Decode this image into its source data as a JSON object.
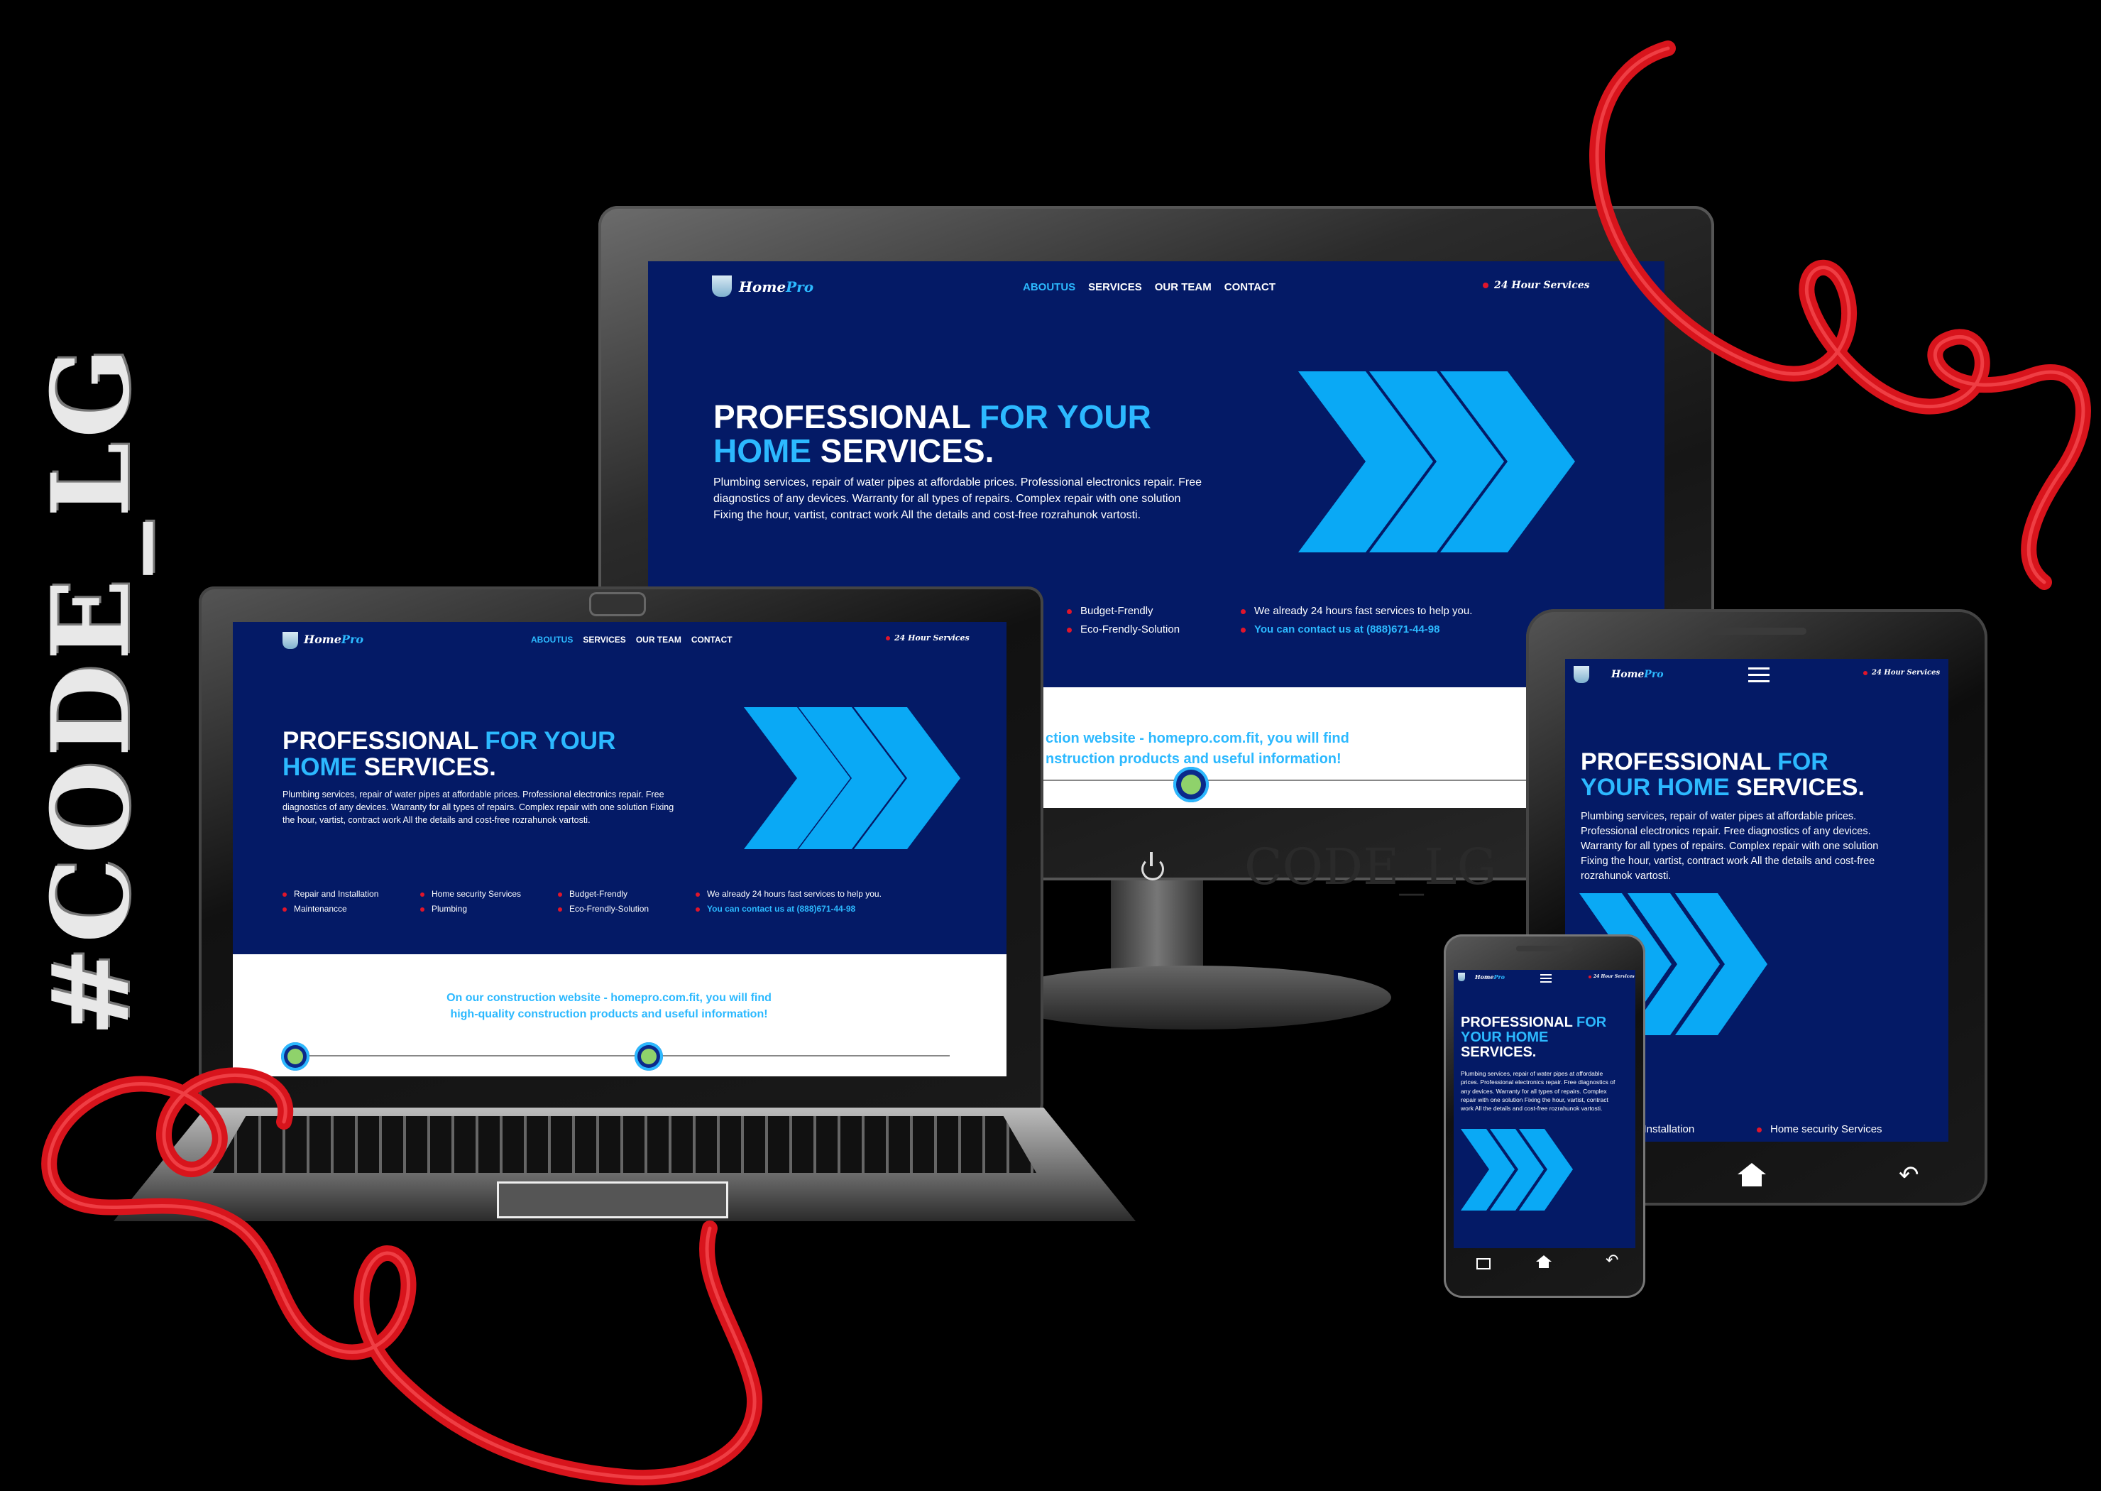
{
  "watermark": {
    "vertical": "#CODE_LG",
    "monitor": "CODE_LG"
  },
  "site": {
    "logo": {
      "home": "Home",
      "pro": "Pro"
    },
    "nav": [
      "ABOUTUS",
      "SERVICES",
      "OUR TEAM",
      "CONTACT"
    ],
    "hours": "24 Hour Services",
    "hero": {
      "line1_white": "PROFESSIONAL",
      "line1_blue": "FOR YOUR",
      "line2_blue": "HOME",
      "line2_white": "SERVICES."
    },
    "hero_tablet": {
      "line1_white": "PROFESSIONAL",
      "line1_blue": "FOR",
      "line2_blue": "YOUR HOME",
      "line2_white": "SERVICES."
    },
    "hero_phone": {
      "line1_white": "PROFESSIONAL",
      "line1_blue": "FOR",
      "line2_blue": "YOUR HOME",
      "line3_white": "SERVICES."
    },
    "description": "Plumbing services, repair of water pipes at affordable prices. Professional electronics repair. Free diagnostics of any devices. Warranty for all types of repairs. Complex repair with one solution Fixing the hour, vartist, contract work All the details and cost-free rozrahunok vartostі.",
    "features": [
      "Repair and Installation",
      "Maintenancce",
      "Home security Services",
      "Plumbing",
      "Budget-Frendly",
      "Eco-Frendly-Solution"
    ],
    "help_line": "We already 24 hours fast services to help you.",
    "contact_line": "You can contact us at (888)671-44-98",
    "bottom_line1": "On our construction website - homepro.com.fit, you will find",
    "bottom_line2": "high-quality construction products and useful information!",
    "monitor_bottom_line1": "ction website - homepro.com.fit, you will find",
    "monitor_bottom_line2": "nstruction products and useful information!",
    "tablet_partial_feature": "d Installation"
  },
  "colors": {
    "bg": "#041a66",
    "accent": "#2cb9ff",
    "bullet": "#e0152b",
    "ribbon": "#d8141c"
  }
}
